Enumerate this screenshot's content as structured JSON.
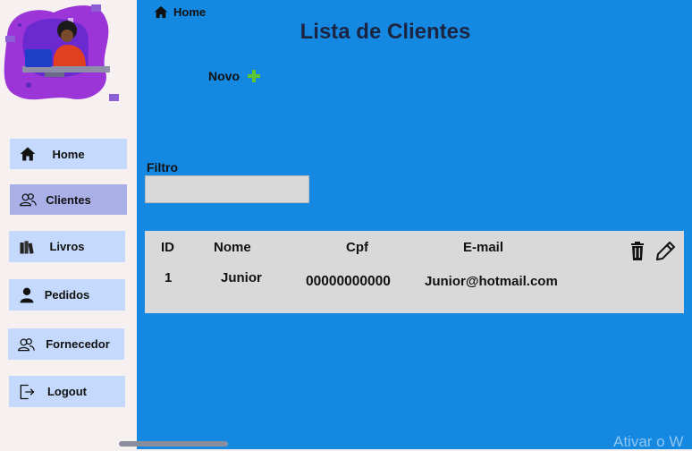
{
  "breadcrumb": {
    "home_label": "Home",
    "icon": "home-icon"
  },
  "page": {
    "title": "Lista de Clientes"
  },
  "actions": {
    "new_label": "Novo",
    "new_icon": "plus-icon"
  },
  "filter": {
    "label": "Filtro",
    "value": "",
    "placeholder": ""
  },
  "sidebar": {
    "items": [
      {
        "label": "Home",
        "icon": "home-icon",
        "active": false
      },
      {
        "label": "Clientes",
        "icon": "users-icon",
        "active": true
      },
      {
        "label": "Livros",
        "icon": "books-icon",
        "active": false
      },
      {
        "label": "Pedidos",
        "icon": "person-icon",
        "active": false
      },
      {
        "label": "Fornecedor",
        "icon": "users-icon",
        "active": false
      },
      {
        "label": "Logout",
        "icon": "logout-icon",
        "active": false
      }
    ]
  },
  "table": {
    "headers": [
      "ID",
      "Nome",
      "Cpf",
      "E-mail"
    ],
    "rows": [
      {
        "id": "1",
        "nome": "Junior",
        "cpf": "00000000000",
        "email": "Junior@hotmail.com"
      }
    ],
    "action_icons": [
      "trash-icon",
      "pencil-icon"
    ]
  },
  "watermark": {
    "text": "Ativar o W"
  },
  "colors": {
    "main_bg": "#1589e2",
    "sidebar_bg": "#f6f1f0",
    "nav_btn": "#c4d9fb",
    "nav_active": "#a9b0e8",
    "table_bg": "#d9d9d9",
    "plus": "#5cc531"
  }
}
